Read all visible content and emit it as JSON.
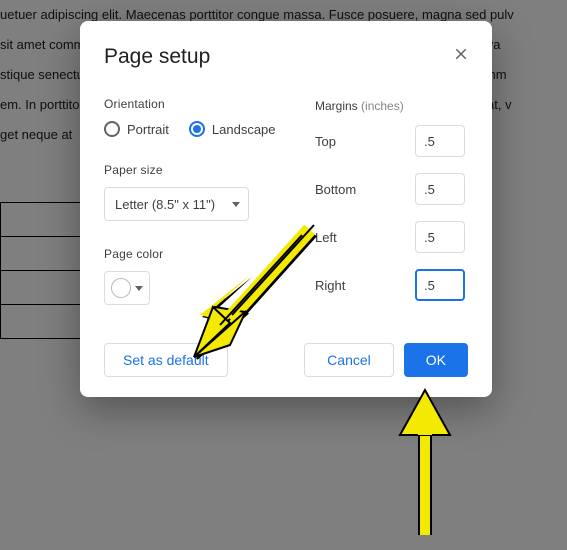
{
  "bg": {
    "line1": "uetuer adipiscing elit. Maecenas porttitor congue massa. Fusce posuere, magna sed pulv",
    "line2": "sit amet commodo magna eros quis urna. Nunc viverra imperdiet enim. Fusce est. Viva",
    "line3": "stique senectus et netus et malesuada fames ac turpis egestas. Proin pharetra nonumm",
    "line4": "em. In porttitor. Donec laoreet nonummy augue. Suspendisse dui purus, scelerisque at, v",
    "line5": "get neque at"
  },
  "dialog": {
    "title": "Page setup",
    "orientation": {
      "label": "Orientation",
      "portrait": "Portrait",
      "landscape": "Landscape"
    },
    "paper": {
      "label": "Paper size",
      "value": "Letter (8.5\" x 11\")"
    },
    "pagecolor": {
      "label": "Page color"
    },
    "margins": {
      "label": "Margins",
      "unit": "(inches)",
      "top": {
        "label": "Top",
        "value": ".5"
      },
      "bottom": {
        "label": "Bottom",
        "value": ".5"
      },
      "left": {
        "label": "Left",
        "value": ".5"
      },
      "right": {
        "label": "Right",
        "value": ".5"
      }
    },
    "actions": {
      "default": "Set as default",
      "cancel": "Cancel",
      "ok": "OK"
    }
  }
}
